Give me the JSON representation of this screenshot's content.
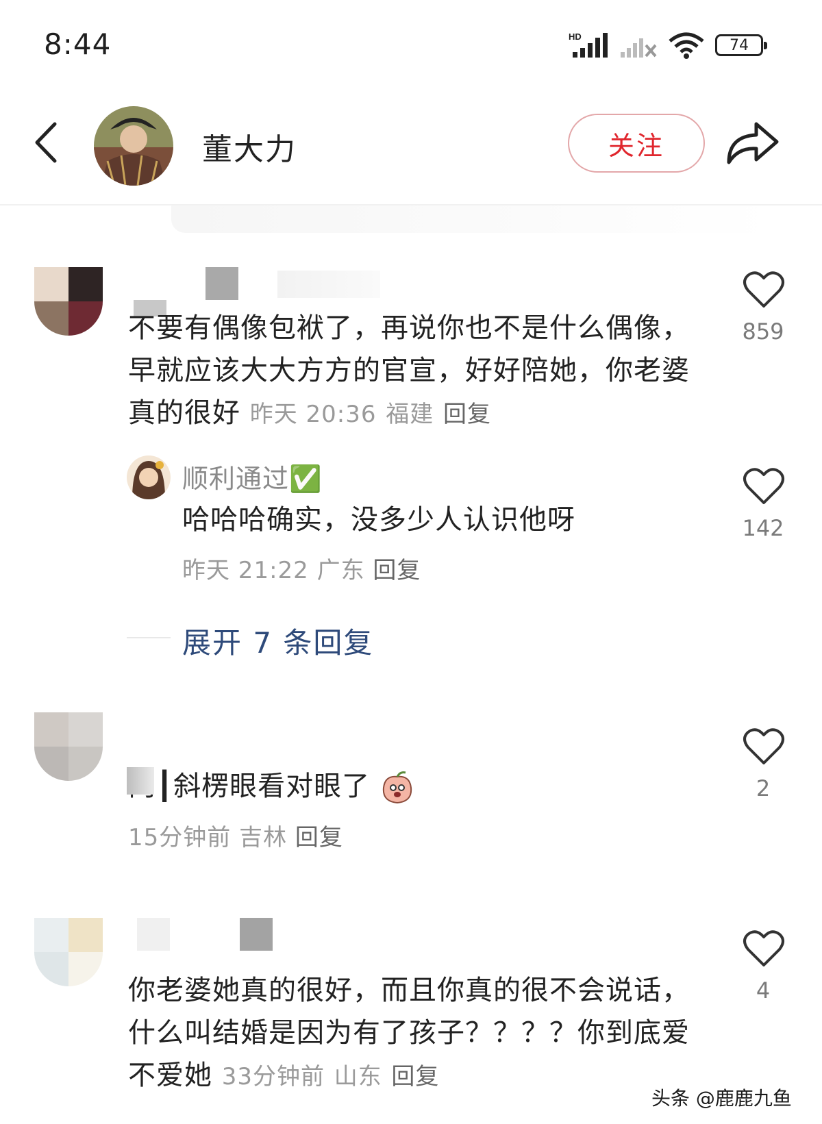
{
  "status_bar": {
    "time": "8:44",
    "network": "HD",
    "battery": "74"
  },
  "header": {
    "username": "董大力",
    "follow_label": "关注"
  },
  "comments": [
    {
      "text": "不要有偶像包袱了，再说你也不是什么偶像，早就应该大大方方的官宣，好好陪她，你老婆真的很好",
      "time": "昨天 20:36",
      "location": "福建",
      "reply_label": "回复",
      "likes": "859"
    },
    {
      "text": "两┃斜楞眼看对眼了",
      "time": "15分钟前",
      "location": "吉林",
      "reply_label": "回复",
      "likes": "2"
    },
    {
      "text": "你老婆她真的很好，而且你真的很不会说话，什么叫结婚是因为有了孩子？？？？你到底爱不爱她",
      "time": "33分钟前",
      "location": "山东",
      "reply_label": "回复",
      "likes": "4"
    }
  ],
  "reply": {
    "username": "顺利通过✅",
    "text": "哈哈哈确实，没多少人认识他呀",
    "time": "昨天 21:22",
    "location": "广东",
    "reply_label": "回复",
    "likes": "142"
  },
  "expand_replies": "展开 7 条回复",
  "watermark": "头条 @鹿鹿九鱼",
  "colors": {
    "accent_red": "#e0262d",
    "link_blue": "#2e4a7a",
    "meta_gray": "#9a9a9a"
  }
}
